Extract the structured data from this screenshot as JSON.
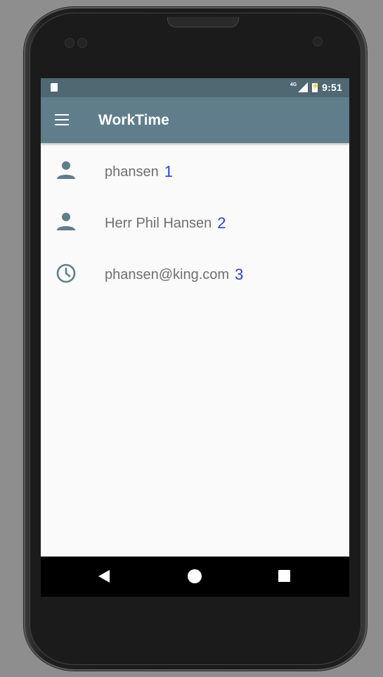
{
  "status_bar": {
    "network_label": "4G",
    "time": "9:51"
  },
  "app_bar": {
    "title": "WorkTime",
    "menu_icon": "hamburger-menu-icon"
  },
  "list": {
    "items": [
      {
        "icon": "person-icon",
        "text": "phansen",
        "marker": "1"
      },
      {
        "icon": "person-icon",
        "text": "Herr Phil Hansen",
        "marker": "2"
      },
      {
        "icon": "clock-icon",
        "text": "phansen@king.com",
        "marker": "3"
      }
    ]
  },
  "nav_bar": {
    "back_icon": "back-triangle-icon",
    "home_icon": "home-circle-icon",
    "recent_icon": "recent-apps-square-icon"
  },
  "colors": {
    "status_bar": "#4f6872",
    "app_bar": "#607d8b",
    "icon_tint": "#607d8b",
    "list_text": "#6f6f6f",
    "marker_text": "#2d45c8",
    "screen_background": "#fafafa"
  }
}
